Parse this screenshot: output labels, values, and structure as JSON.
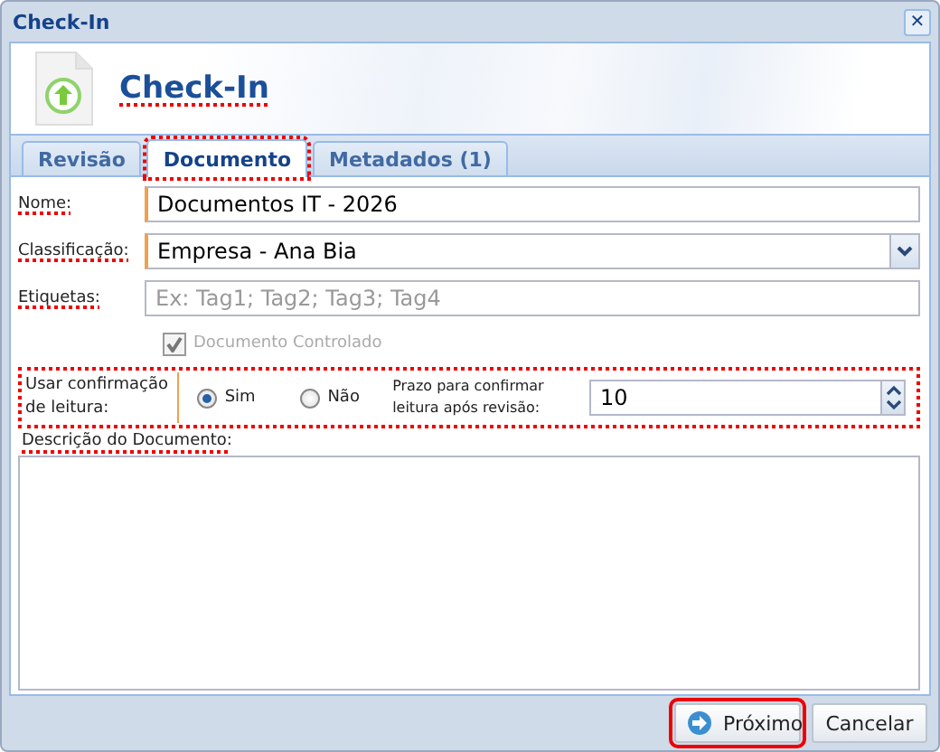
{
  "window": {
    "title": "Check-In",
    "close_glyph": "✕"
  },
  "header": {
    "title": "Check-In",
    "highlighted": true
  },
  "tabs": [
    {
      "label": "Revisão",
      "selected": false,
      "highlighted": false
    },
    {
      "label": "Documento",
      "selected": true,
      "highlighted": true
    },
    {
      "label": "Metadados (1)",
      "selected": false,
      "highlighted": false
    }
  ],
  "fields": [
    {
      "kind": "text",
      "label": "Nome:",
      "label_highlighted": true,
      "value": "Documentos IT - 2026"
    },
    {
      "kind": "combo",
      "label": "Classificação:",
      "label_highlighted": true,
      "value": "Empresa - Ana Bia"
    },
    {
      "kind": "text",
      "label": "Etiquetas:",
      "label_highlighted": true,
      "placeholder": "Ex: Tag1; Tag2; Tag3; Tag4"
    }
  ],
  "controlled_checkbox": {
    "label": "Documento Controlado",
    "checked": true,
    "disabled": true
  },
  "read_confirmation": {
    "highlighted": true,
    "label": "Usar confirmação de leitura:",
    "options": [
      {
        "label": "Sim",
        "selected": true
      },
      {
        "label": "Não",
        "selected": false
      }
    ],
    "deadline_label": "Prazo para confirmar leitura após revisão:",
    "deadline_value": "10"
  },
  "description": {
    "label": "Descrição do Documento:",
    "label_highlighted": true
  },
  "buttons": [
    {
      "kind": "primary",
      "label": "Próximo",
      "highlighted": true
    },
    {
      "kind": "plain",
      "label": "Cancelar",
      "highlighted": false
    }
  ]
}
